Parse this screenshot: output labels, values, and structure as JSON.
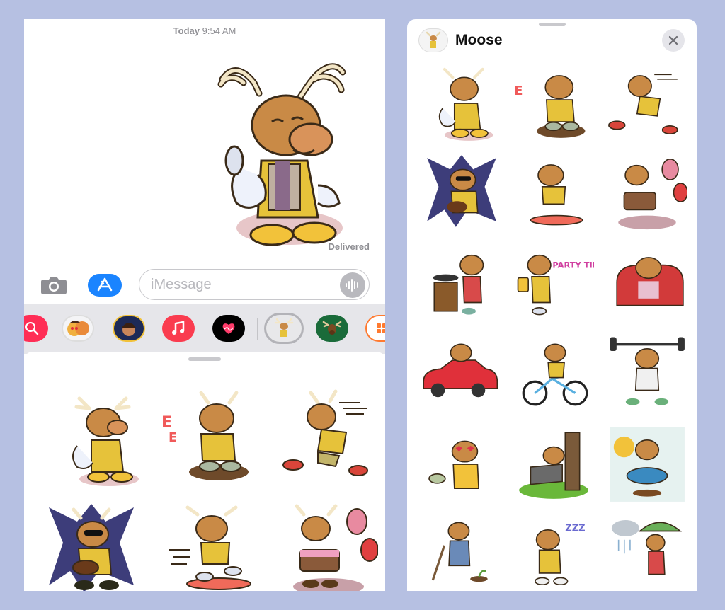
{
  "conversation": {
    "timestamp_day": "Today",
    "timestamp_time": "9:54 AM",
    "status": "Delivered"
  },
  "compose": {
    "placeholder": "iMessage"
  },
  "app_strip": {
    "icons": [
      "search-images-app",
      "memoji-stickers-app",
      "memoji-app",
      "music-app",
      "digital-touch-app",
      "moose-stickers-app",
      "moose-stickers-app-2",
      "more-apps"
    ],
    "colors": {
      "search": "#ff2d55",
      "music": "#fa3c4f",
      "touch": "#000000",
      "moose_bg": "#1a6b3a"
    }
  },
  "sticker_pack": {
    "title": "Moose",
    "stickers": [
      "moose-thumbs-up",
      "moose-angry-stomp",
      "moose-running",
      "moose-rock-guitar",
      "moose-skateboard",
      "moose-birthday-cake",
      "moose-cooking",
      "moose-party-time",
      "moose-relax-coffee",
      "moose-car-driving",
      "moose-bicycle",
      "moose-weightlifting",
      "moose-love-eyes",
      "moose-napping-tree",
      "moose-swim-ring",
      "moose-digging",
      "moose-sleeping-zzz",
      "moose-rain-umbrella"
    ],
    "party_text": "PARTY TIME"
  },
  "colors": {
    "accent_blue": "#1a84ff",
    "moose_fur": "#c98a46",
    "antler": "#f3e6c6",
    "background": "#b6c0e2"
  }
}
